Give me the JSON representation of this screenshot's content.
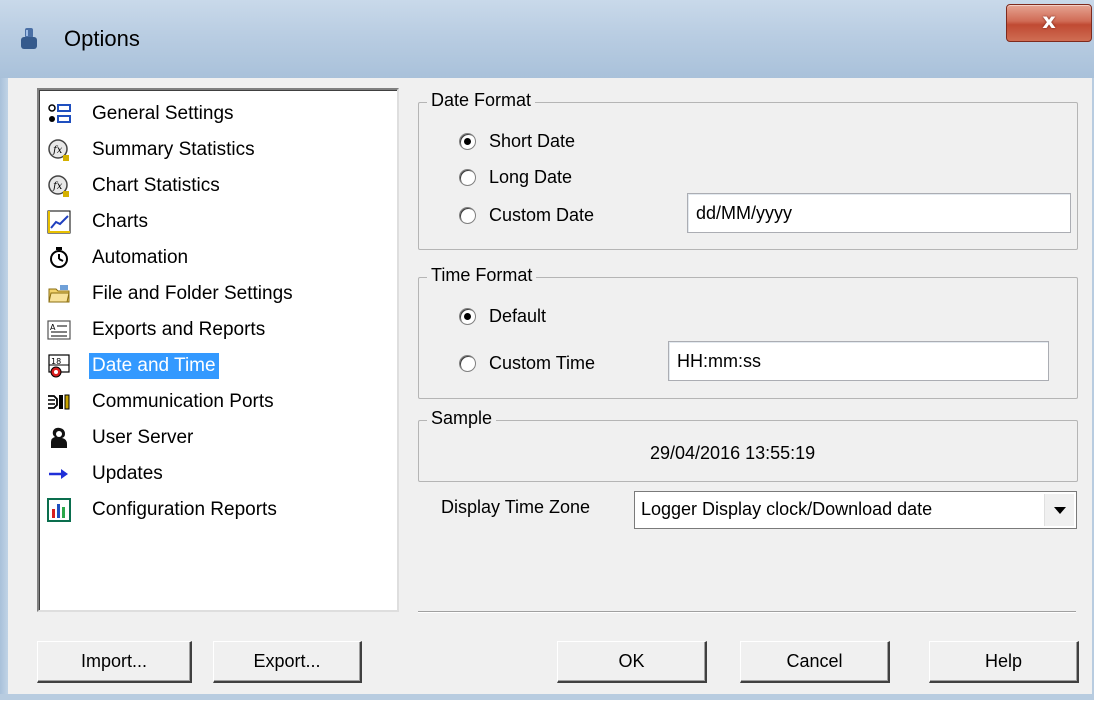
{
  "window": {
    "title": "Options",
    "close_label": "x"
  },
  "tree": {
    "items": [
      {
        "label": "General Settings",
        "icon": "general-settings-icon",
        "selected": false
      },
      {
        "label": "Summary Statistics",
        "icon": "function-icon",
        "selected": false
      },
      {
        "label": "Chart Statistics",
        "icon": "function-icon",
        "selected": false
      },
      {
        "label": "Charts",
        "icon": "line-chart-icon",
        "selected": false
      },
      {
        "label": "Automation",
        "icon": "stopwatch-icon",
        "selected": false
      },
      {
        "label": "File and Folder Settings",
        "icon": "folder-icon",
        "selected": false
      },
      {
        "label": "Exports and Reports",
        "icon": "report-icon",
        "selected": false
      },
      {
        "label": "Date and Time",
        "icon": "calendar-clock-icon",
        "selected": true
      },
      {
        "label": "Communication Ports",
        "icon": "port-icon",
        "selected": false
      },
      {
        "label": "User Server",
        "icon": "user-icon",
        "selected": false
      },
      {
        "label": "Updates",
        "icon": "arrow-right-icon",
        "selected": false
      },
      {
        "label": "Configuration Reports",
        "icon": "config-report-icon",
        "selected": false
      }
    ]
  },
  "date_format": {
    "legend": "Date Format",
    "options": [
      {
        "label": "Short Date",
        "checked": true
      },
      {
        "label": "Long Date",
        "checked": false
      },
      {
        "label": "Custom Date",
        "checked": false
      }
    ],
    "custom_value": "dd/MM/yyyy"
  },
  "time_format": {
    "legend": "Time Format",
    "options": [
      {
        "label": "Default",
        "checked": true
      },
      {
        "label": "Custom Time",
        "checked": false
      }
    ],
    "custom_value": "HH:mm:ss"
  },
  "sample": {
    "legend": "Sample",
    "value": "29/04/2016 13:55:19"
  },
  "display_time_zone": {
    "label": "Display Time Zone",
    "selected": "Logger Display clock/Download date"
  },
  "buttons": {
    "import": "Import...",
    "export": "Export...",
    "ok": "OK",
    "cancel": "Cancel",
    "help": "Help"
  },
  "colors": {
    "selection": "#3399ff",
    "dialog_bg": "#f0f0f0",
    "titlebar": "#b9cde2",
    "close_button": "#c75a42"
  }
}
